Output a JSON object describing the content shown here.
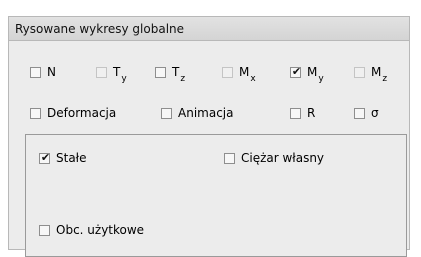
{
  "panel": {
    "title": "Rysowane wykresy globalne"
  },
  "row1": [
    {
      "sym": "N",
      "sub": "",
      "checked": false,
      "enabled": true
    },
    {
      "sym": "T",
      "sub": "y",
      "checked": false,
      "enabled": false
    },
    {
      "sym": "T",
      "sub": "z",
      "checked": false,
      "enabled": true
    },
    {
      "sym": "M",
      "sub": "x",
      "checked": false,
      "enabled": false
    },
    {
      "sym": "M",
      "sub": "y",
      "checked": true,
      "enabled": true
    },
    {
      "sym": "M",
      "sub": "z",
      "checked": false,
      "enabled": false
    }
  ],
  "row2": [
    {
      "label": "Deformacja",
      "checked": false
    },
    {
      "label": "Animacja",
      "checked": false
    },
    {
      "label": "R",
      "checked": false
    },
    {
      "label": "σ",
      "checked": false
    }
  ],
  "loads": [
    {
      "label": "Stałe",
      "checked": true
    },
    {
      "label": "Ciężar własny",
      "checked": false
    },
    {
      "label": "Obc. użytkowe",
      "checked": false
    }
  ],
  "check_glyph": "✔"
}
